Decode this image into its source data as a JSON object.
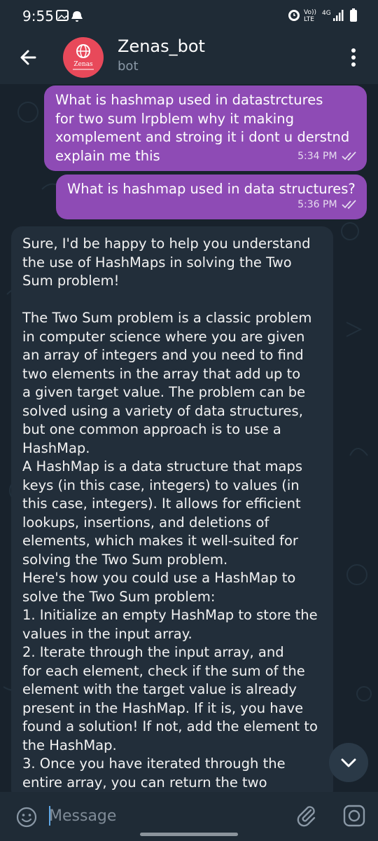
{
  "status_bar": {
    "time": "9:55",
    "network_label_top": "Vo))",
    "network_label_bottom": "LTE",
    "network_gen": "4G"
  },
  "header": {
    "bot_name": "Zenas_bot",
    "bot_status": "bot",
    "avatar_text": "Zenas"
  },
  "messages": {
    "out1": {
      "text": "What is hashmap used in datastrctures\nfor two sum lrpblem why it making\nxomplement and stroing it i dont u derstnd\nexplain me this",
      "time": "5:34 PM"
    },
    "out2": {
      "text": "What is hashmap used in data structures?",
      "time": "5:36 PM"
    },
    "in1": {
      "text": "Sure, I'd be happy to help you understand\nthe use of HashMaps in solving the Two\nSum problem!\n\nThe Two Sum problem is a classic problem\nin computer science where you are given\nan array of integers and you need to find\ntwo elements in the array that add up to\na given target value. The problem can be\nsolved using a variety of data structures,\nbut one common approach is to use a\nHashMap.\nA HashMap is a data structure that maps\nkeys (in this case, integers) to values (in\nthis case, integers). It allows for efficient\nlookups, insertions, and deletions of\nelements, which makes it well-suited for\nsolving the Two Sum problem.\nHere's how you could use a HashMap to\nsolve the Two Sum problem:\n1. Initialize an empty HashMap to store the\nvalues in the input array.\n2. Iterate through the input array, and\nfor each element, check if the sum of the\nelement with the target value is already\npresent in the HashMap. If it is, you have\nfound a solution! If not, add the element to\nthe HashMap.\n3. Once you have iterated through the\nentire array, you can return the two"
    }
  },
  "composer": {
    "placeholder": "Message"
  },
  "colors": {
    "outgoing_bubble": "#8e4bb5",
    "incoming_bubble": "#222e3a",
    "header_bg": "#1f2b36",
    "avatar_bg": "#e8495a"
  },
  "icons": [
    "back-arrow-icon",
    "more-vert-icon",
    "emoji-icon",
    "attach-icon",
    "camera-icon",
    "chevron-down-icon",
    "double-check-icon"
  ]
}
